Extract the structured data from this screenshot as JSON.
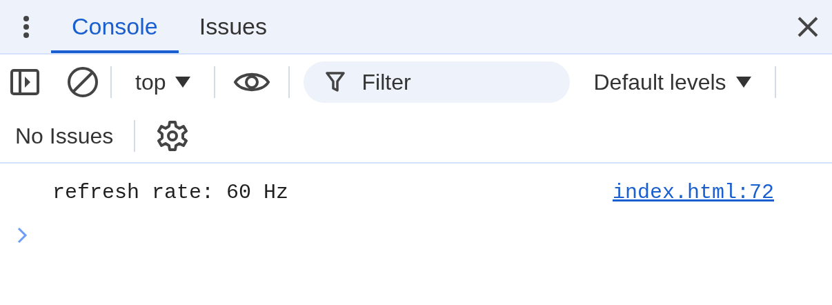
{
  "tabs": [
    {
      "label": "Console",
      "selected": true
    },
    {
      "label": "Issues",
      "selected": false
    }
  ],
  "toolbar": {
    "context": "top",
    "filter": {
      "placeholder": "Filter"
    },
    "levels": "Default levels"
  },
  "issues_bar": {
    "label": "No Issues"
  },
  "messages": [
    {
      "text": "refresh rate: 60 Hz",
      "source": "index.html:72"
    }
  ]
}
